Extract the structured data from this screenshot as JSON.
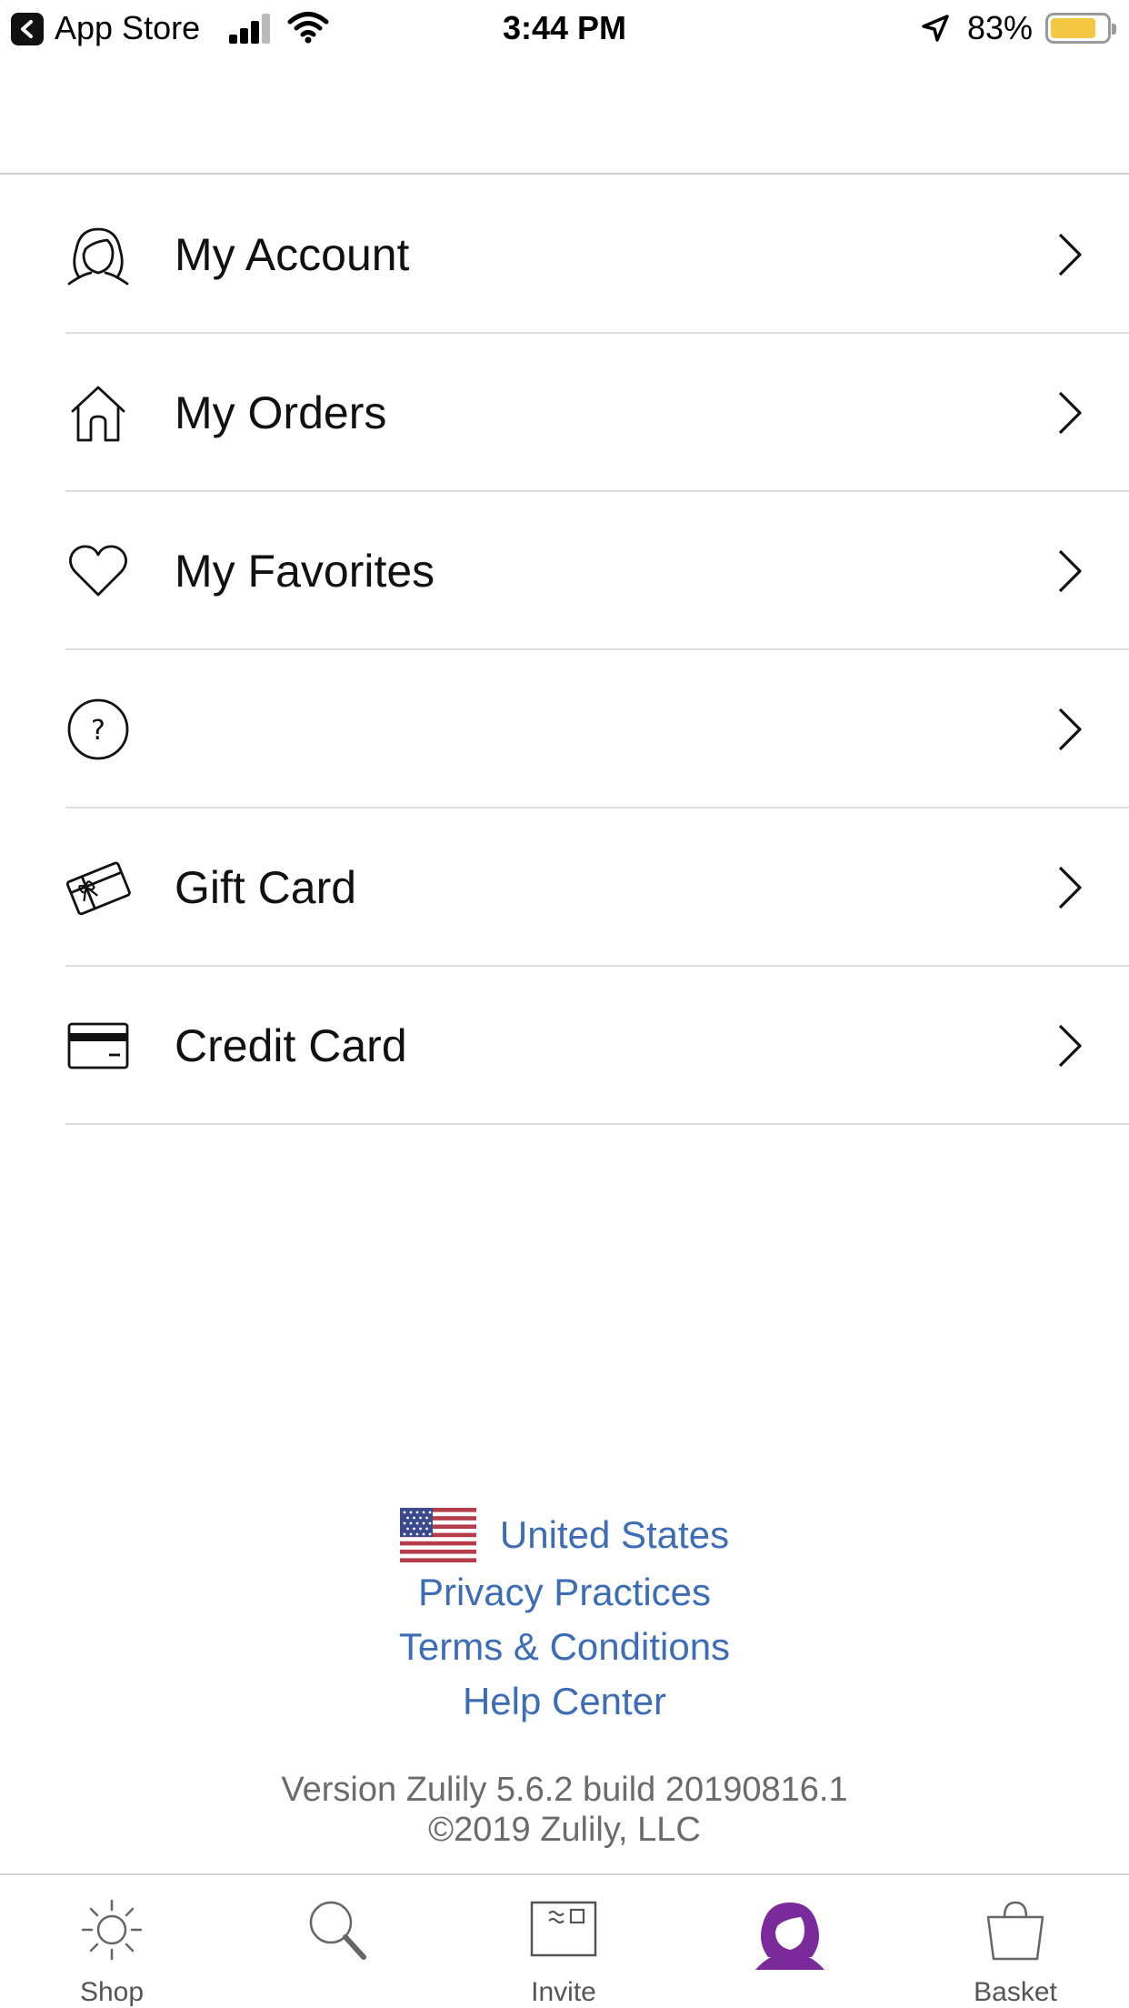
{
  "status_bar": {
    "back_label": "App Store",
    "time": "3:44 PM",
    "battery_percent": "83%",
    "battery_level": 0.83
  },
  "header": {
    "title": ""
  },
  "menu": {
    "items": [
      {
        "label": "My Account",
        "icon": "user-avatar-icon"
      },
      {
        "label": "My Orders",
        "icon": "house-icon"
      },
      {
        "label": "My Favorites",
        "icon": "heart-icon"
      },
      {
        "label": "",
        "icon": "question-circle-icon"
      },
      {
        "label": "Gift Card",
        "icon": "gift-card-icon"
      },
      {
        "label": "Credit Card",
        "icon": "credit-card-icon"
      }
    ]
  },
  "footer": {
    "country": "United States",
    "privacy": "Privacy Practices",
    "terms": "Terms & Conditions",
    "help": "Help Center",
    "version": "Version Zulily 5.6.2 build 20190816.1",
    "copyright": "©2019 Zulily, LLC"
  },
  "tabs": [
    {
      "label": "Shop",
      "icon": "sun-icon"
    },
    {
      "label": "",
      "icon": "search-icon"
    },
    {
      "label": "Invite",
      "icon": "invite-card-icon"
    },
    {
      "label": "",
      "icon": "account-avatar-icon",
      "active": true
    },
    {
      "label": "Basket",
      "icon": "shopping-bag-icon"
    }
  ],
  "colors": {
    "link": "#3d6db5",
    "active_tab": "#7a2a9a",
    "battery": "#f4c842"
  }
}
